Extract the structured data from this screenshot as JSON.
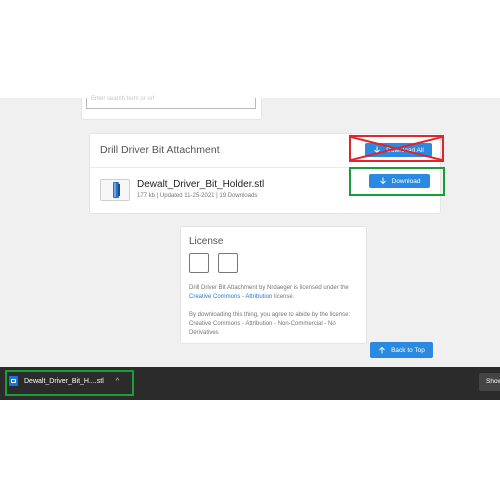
{
  "top_input": {
    "text": "Enter search term or url"
  },
  "thing": {
    "title": "Drill Driver Bit Attachment",
    "download_all_label": "Download All",
    "file": {
      "name": "Dewalt_Driver_Bit_Holder.stl",
      "meta": "177 kb | Updated 11-25-2021 | 19 Downloads",
      "download_label": "Download"
    }
  },
  "license": {
    "title": "License",
    "line1_pre": "Drill Driver Bit Attachment by",
    "author": "Nrdaeger",
    "line1_post": "is licensed under the",
    "license_link": "Creative Commons - Attribution",
    "line1_end": "license.",
    "line2": "By downloading this thing, you agree to abide by the license: Creative Commons - Attribution - Non-Commercial - No Derivatives"
  },
  "back_to_top_label": "Back to Top",
  "download_bar": {
    "item_name": "Dewalt_Driver_Bit_H....stl",
    "chevron": "^",
    "show_all_label": "Show all"
  },
  "annotations": {
    "red_box_color": "#e1252a",
    "green_box_color": "#1a9c3b"
  },
  "colors": {
    "accent": "#2a8ae2",
    "download_bar_bg": "#2b2b2b",
    "page_bg": "#f0f0f0"
  }
}
